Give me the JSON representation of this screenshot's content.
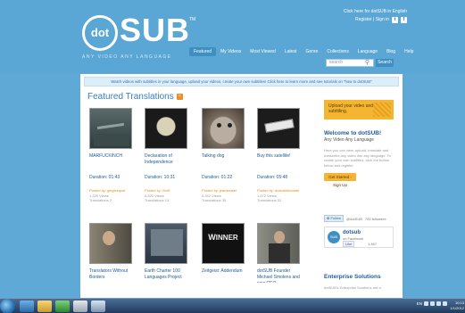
{
  "header": {
    "logo_main": "SUB",
    "logo_dot": "dot",
    "logo_tm": "TM",
    "tagline": "ANY VIDEO ANY LANGUAGE",
    "top_link_language": "Click here for dotSUB in English",
    "register_signin": "Register | Sign in",
    "nav": [
      "Featured",
      "My Videos",
      "Most Viewed",
      "Latest",
      "Genre",
      "Collections",
      "Language",
      "Blog",
      "Help"
    ],
    "search_placeholder": "search",
    "search_button": "Search"
  },
  "info_bar": "Watch videos with subtitles in your language, upload your videos, create your own subtitles! Click here to learn more and see tutorials on \"how to dotSUB\"",
  "featured": {
    "title": "Featured Translations",
    "cards": [
      {
        "title": "MARFUCKINCH",
        "duration": "Duration: 01:43",
        "posted": "Posted by: ginglesquai",
        "views": "1,229 Views",
        "translations": "Translations 2"
      },
      {
        "title": "Declaration of Independence",
        "duration": "Duration: 10:31",
        "posted": "Posted by: Wolf",
        "views": "6,520 Views",
        "translations": "Translations 13"
      },
      {
        "title": "Talking dog",
        "duration": "Duration: 01:22",
        "posted": "Posted by: jeanlesaibi",
        "views": "6,347 Views",
        "translations": "Translations 35"
      },
      {
        "title": "Buy this satellite!",
        "duration": "Duration: 05:48",
        "posted": "Posted by: dotsubinfocarte",
        "views": "1,672 Views",
        "translations": "Translations 32"
      },
      {
        "title": "Translators Without Borders",
        "duration": "",
        "posted": "",
        "views": "",
        "translations": ""
      },
      {
        "title": "Earth Charter 100 Languages Project",
        "duration": "",
        "posted": "",
        "views": "",
        "translations": ""
      },
      {
        "title": "Zeitgeist: Addendum",
        "duration": "",
        "posted": "",
        "views": "",
        "translations": ""
      },
      {
        "title": "dotSUB Founder Michael Smolens and new CEO",
        "duration": "",
        "posted": "",
        "views": "",
        "translations": ""
      }
    ]
  },
  "sidebar": {
    "upload_text": "Upload your video and begin subtitling.",
    "welcome_title": "Welcome to dotSUB!",
    "welcome_sub": "Any Video Any Language",
    "welcome_text": "Here you can view, upload, translate and transcribe any video into any language. To create your own subtitles, click the button below and register.",
    "get_started": "Get Started - Sign Up",
    "follow_label": "Follow",
    "follow_handle": "@dotSUB",
    "followers": "700 followers",
    "fb_name": "dotsub",
    "fb_on": "on Facebook",
    "fb_like": "Like",
    "fb_count": "1,467",
    "enterprise_title": "Enterprise Solutions",
    "enterprise_text": "dotSUB's Enterprise Solutions are a"
  },
  "taskbar": {
    "lang": "EN",
    "time": "10:13",
    "date": "1/1/2012"
  },
  "colors": {
    "header_blue": "#5aa6d4",
    "accent_orange": "#f4b533",
    "link_blue": "#1f5a9a"
  }
}
